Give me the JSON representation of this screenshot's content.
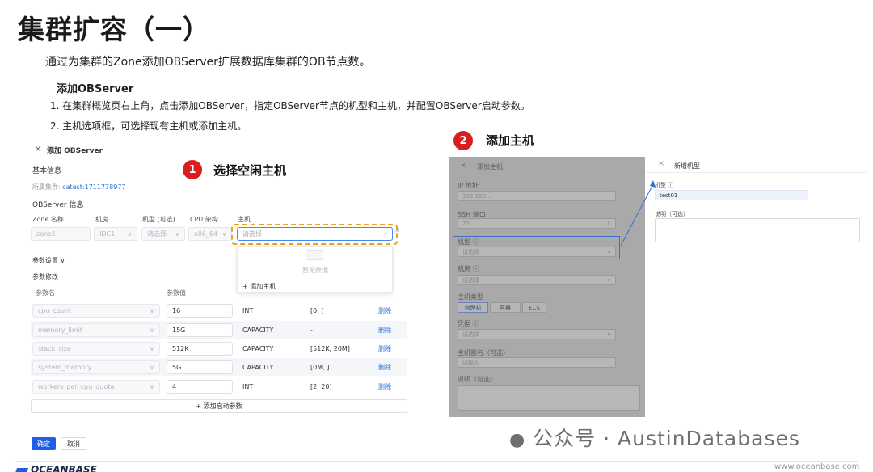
{
  "slide": {
    "title": "集群扩容（一）",
    "subtitle": "通过为集群的Zone添加OBServer扩展数据库集群的OB节点数。",
    "section_heading": "添加OBServer",
    "steps": [
      "1. 在集群概览页右上角，点击添加OBServer，指定OBServer节点的机型和主机，并配置OBServer启动参数。",
      "2. 主机选项框，可选择现有主机或添加主机。"
    ]
  },
  "callouts": [
    {
      "number": "1",
      "label": "选择空闲主机"
    },
    {
      "number": "2",
      "label": "添加主机"
    }
  ],
  "add_observer": {
    "close": "×",
    "title": "添加 OBServer",
    "basic_info": "基本信息",
    "cluster_label": "所属集群:",
    "cluster_value": "catest:1711778977",
    "observer_info": "OBServer 信息",
    "columns": [
      "Zone 名称",
      "机房",
      "机型 (可选)",
      "CPU 架构",
      "主机"
    ],
    "zone_value": "zone1",
    "idc_value": "IDC1",
    "model_placeholder": "请选择",
    "cpu_value": "x86_64",
    "host_placeholder": "请选择",
    "dropdown_empty": "暂无数据",
    "dropdown_add_host": "+ 添加主机",
    "param_settings": "参数设置",
    "param_modify": "参数修改",
    "param_headers": [
      "参数名",
      "参数值"
    ],
    "params": [
      {
        "name": "cpu_count",
        "value": "16",
        "type": "INT",
        "range": "[0, ]",
        "action": "删除"
      },
      {
        "name": "memory_limit",
        "value": "15G",
        "type": "CAPACITY",
        "range": "-",
        "action": "删除"
      },
      {
        "name": "stack_size",
        "value": "512K",
        "type": "CAPACITY",
        "range": "[512K, 20M]",
        "action": "删除"
      },
      {
        "name": "system_memory",
        "value": "5G",
        "type": "CAPACITY",
        "range": "[0M, ]",
        "action": "删除"
      },
      {
        "name": "workers_per_cpu_quota",
        "value": "4",
        "type": "INT",
        "range": "[2, 20]",
        "action": "删除"
      }
    ],
    "add_param": "+ 添加启动参数",
    "confirm": "确定",
    "cancel": "取消"
  },
  "add_host": {
    "close": "×",
    "title": "添加主机",
    "ip_label": "IP 地址",
    "ip_value": "192.168...",
    "ssh_label": "SSH 端口",
    "ssh_value": "22",
    "model_label": "机型",
    "model_placeholder": "请选择",
    "room_label": "机房",
    "room_placeholder": "请选择",
    "host_type_label": "主机类型",
    "host_types": [
      "物理机",
      "容器",
      "ECS"
    ],
    "credential_label": "凭据",
    "credential_placeholder": "请选择",
    "alias_label": "主机别名（可选）",
    "alias_placeholder": "请输入",
    "desc_label": "说明（可选）"
  },
  "new_model": {
    "close": "×",
    "title": "新增机型",
    "model_label": "机型",
    "model_value": "test01",
    "desc_label": "说明（可选）"
  },
  "watermark": "公众号 · AustinDatabases",
  "footer": {
    "logo": "OCEANBASE",
    "url": "www.oceanbase.com"
  },
  "colors": {
    "badge": "#d81e1e",
    "primary": "#1f5ee8",
    "highlight": "#f0a020",
    "link": "#1f6fd8"
  }
}
